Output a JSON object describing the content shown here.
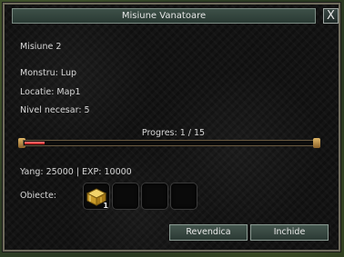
{
  "window": {
    "title": "Misiune Vanatoare",
    "close_label": "X"
  },
  "mission": {
    "name": "Misiune 2",
    "monster": "Monstru: Lup",
    "location": "Locatie: Map1",
    "level": "Nivel necesar: 5"
  },
  "progress": {
    "label": "Progres: 1 / 15",
    "current": 1,
    "total": 15
  },
  "rewards": {
    "text": "Yang: 25000 | EXP: 10000",
    "items_label": "Obiecte:",
    "slots": [
      {
        "item": "gold-chest-icon",
        "count": "1"
      },
      {
        "item": "",
        "count": ""
      },
      {
        "item": "",
        "count": ""
      },
      {
        "item": "",
        "count": ""
      }
    ]
  },
  "buttons": {
    "claim": "Revendica",
    "close": "Inchide"
  },
  "colors": {
    "window_bg": "#141414",
    "title_bar": "#34463e",
    "progress_fill": "#d42020",
    "text": "#d8d8d8"
  }
}
